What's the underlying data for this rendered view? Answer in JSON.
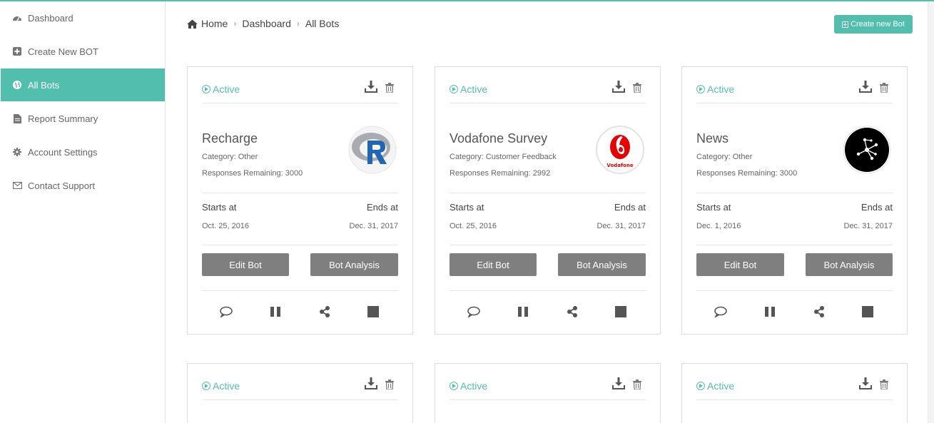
{
  "colors": {
    "accent": "#52bfae",
    "button_gray": "#7f7f7f"
  },
  "sidebar": {
    "items": [
      {
        "label": "Dashboard",
        "icon": "dashboard-icon"
      },
      {
        "label": "Create New BOT",
        "icon": "plus-square-icon"
      },
      {
        "label": "All Bots",
        "icon": "globe-icon",
        "active": true
      },
      {
        "label": "Report Summary",
        "icon": "file-text-icon"
      },
      {
        "label": "Account Settings",
        "icon": "gear-icon"
      },
      {
        "label": "Contact Support",
        "icon": "envelope-icon"
      }
    ]
  },
  "breadcrumb": {
    "home": "Home",
    "dashboard": "Dashboard",
    "current": "All Bots"
  },
  "header": {
    "create_label": "Create new Bot"
  },
  "cards": [
    {
      "status": "Active",
      "name": "Recharge",
      "category": "Category: Other",
      "responses": "Responses Remaining: 3000",
      "starts_label": "Starts at",
      "ends_label": "Ends at",
      "start": "Oct. 25, 2016",
      "end": "Dec. 31, 2017",
      "edit_label": "Edit Bot",
      "analysis_label": "Bot Analysis",
      "logo": "r-logo-icon"
    },
    {
      "status": "Active",
      "name": "Vodafone Survey",
      "category": "Category: Customer Feedback",
      "responses": "Responses Remaining: 2992",
      "starts_label": "Starts at",
      "ends_label": "Ends at",
      "start": "Oct. 25, 2016",
      "end": "Dec. 31, 2017",
      "edit_label": "Edit Bot",
      "analysis_label": "Bot Analysis",
      "logo": "vodafone-logo-icon",
      "logo_text": "Vodafone"
    },
    {
      "status": "Active",
      "name": "News",
      "category": "Category: Other",
      "responses": "Responses Remaining: 3000",
      "starts_label": "Starts at",
      "ends_label": "Ends at",
      "start": "Dec. 1, 2016",
      "end": "Dec. 31, 2017",
      "edit_label": "Edit Bot",
      "analysis_label": "Bot Analysis",
      "logo": "network-logo-icon"
    },
    {
      "status": "Active"
    },
    {
      "status": "Active"
    },
    {
      "status": "Active"
    }
  ]
}
